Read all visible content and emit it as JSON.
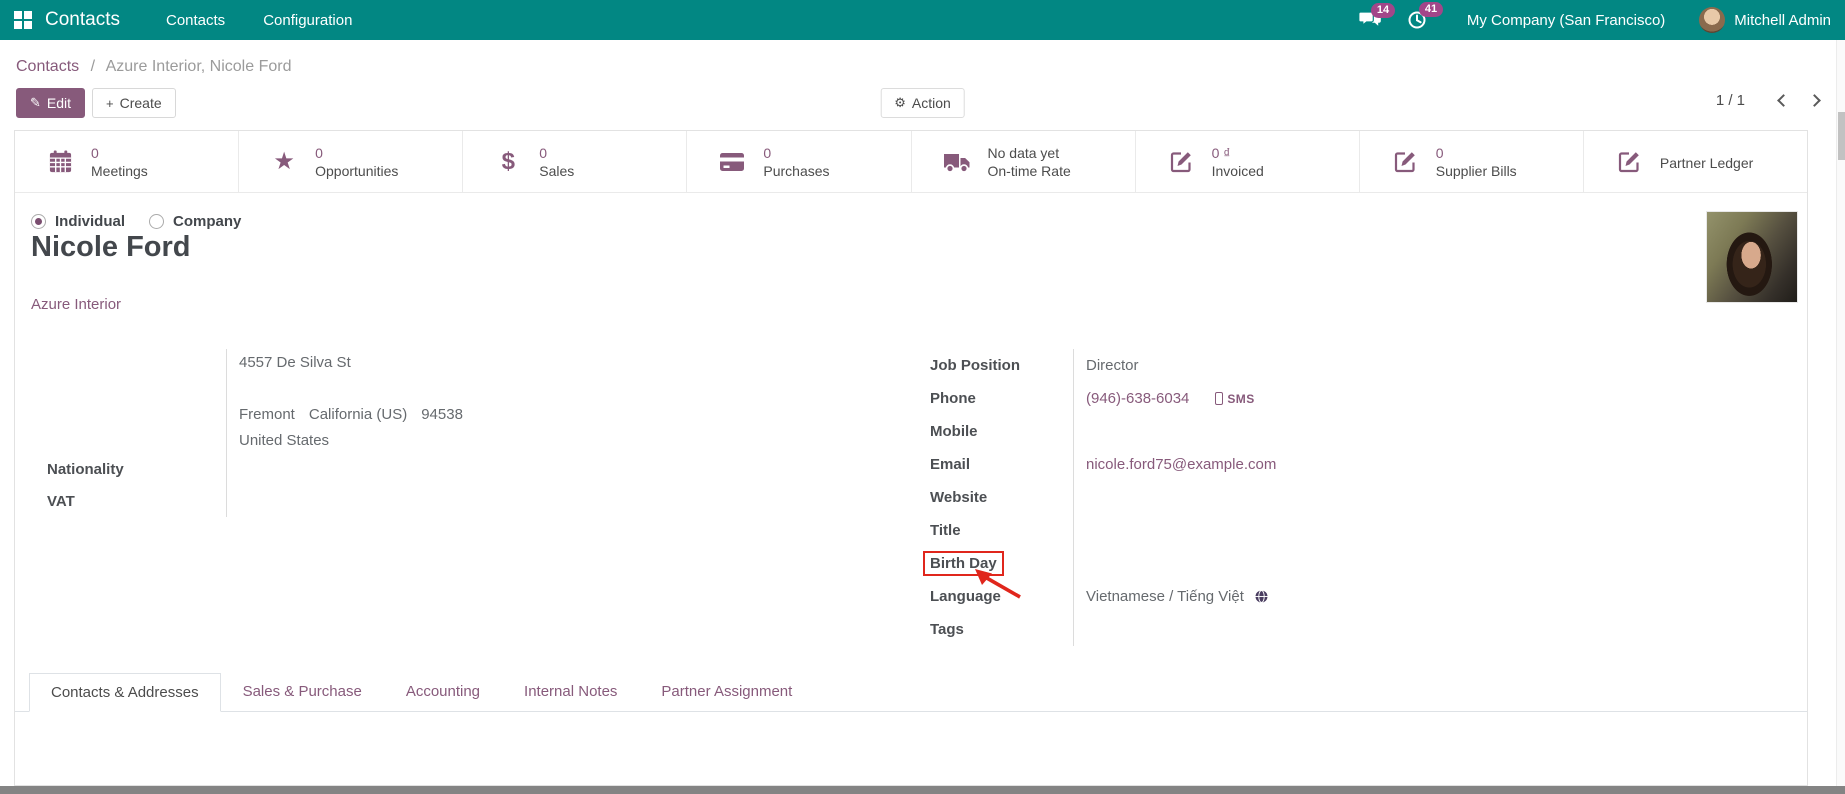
{
  "colors": {
    "navbar_teal": "#028783",
    "accent_purple": "#875a7b",
    "badge_magenta": "#a24689",
    "annotation_red": "#e0261c"
  },
  "navbar": {
    "app_name": "Contacts",
    "menu": [
      "Contacts",
      "Configuration"
    ],
    "messages_badge": "14",
    "activities_badge": "41",
    "company": "My Company (San Francisco)",
    "user": "Mitchell Admin"
  },
  "control_panel": {
    "breadcrumb": {
      "root": "Contacts",
      "separator": "/",
      "current": "Azure Interior, Nicole Ford"
    },
    "edit_label": "Edit",
    "create_label": "Create",
    "action_label": "Action",
    "pager": "1 / 1"
  },
  "stat_buttons": [
    {
      "icon": "calendar-icon",
      "value": "0",
      "label": "Meetings"
    },
    {
      "icon": "star-icon",
      "value": "0",
      "label": "Opportunities"
    },
    {
      "icon": "dollar-icon",
      "value": "0",
      "label": "Sales"
    },
    {
      "icon": "credit-card-icon",
      "value": "0",
      "label": "Purchases"
    },
    {
      "icon": "truck-icon",
      "value": "No data yet",
      "label": "On-time Rate"
    },
    {
      "icon": "edit-square-icon",
      "value": "0 ₫",
      "label": "Invoiced"
    },
    {
      "icon": "edit-square-icon",
      "value": "0",
      "label": "Supplier Bills"
    },
    {
      "icon": "edit-square-icon",
      "value": "",
      "label": "Partner Ledger"
    }
  ],
  "form": {
    "type_options": {
      "individual": "Individual",
      "company": "Company"
    },
    "name": "Nicole Ford",
    "company_link": "Azure Interior",
    "address": {
      "street": "4557 De Silva St",
      "city": "Fremont",
      "state": "California (US)",
      "zip": "94538",
      "country": "United States"
    },
    "labels": {
      "nationality": "Nationality",
      "vat": "VAT",
      "job_position": "Job Position",
      "phone": "Phone",
      "mobile": "Mobile",
      "email": "Email",
      "website": "Website",
      "title": "Title",
      "birthday": "Birth Day",
      "language": "Language",
      "tags": "Tags"
    },
    "values": {
      "job_position": "Director",
      "phone": "(946)-638-6034",
      "sms": "SMS",
      "email": "nicole.ford75@example.com",
      "language": "Vietnamese / Tiếng Việt"
    },
    "tabs": [
      "Contacts & Addresses",
      "Sales & Purchase",
      "Accounting",
      "Internal Notes",
      "Partner Assignment"
    ]
  }
}
